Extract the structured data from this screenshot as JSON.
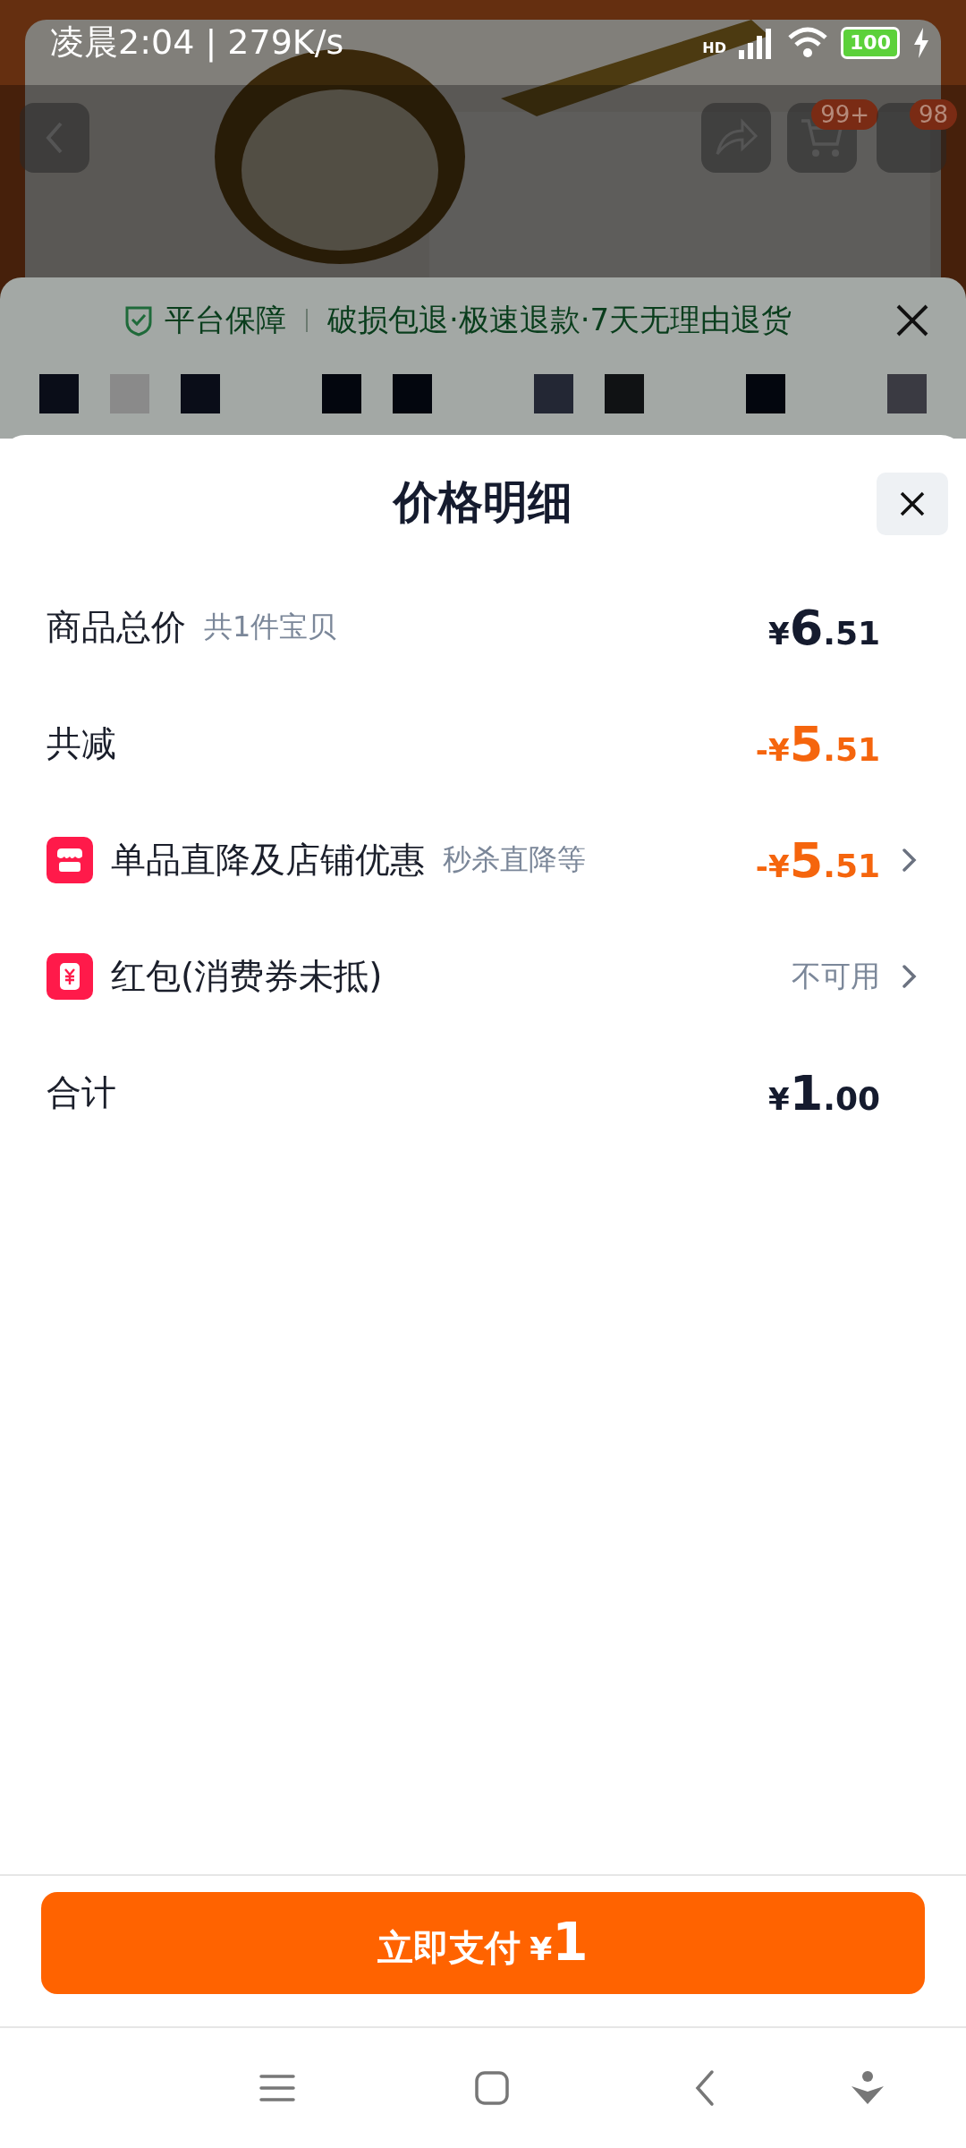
{
  "status_bar": {
    "time": "凌晨2:04 | 279K/s",
    "network": "HD",
    "battery": "100"
  },
  "product_header": {
    "cart_badge": "99+",
    "message_badge": "98"
  },
  "guarantee_bar": {
    "title": "平台保障",
    "text": "破损包退·极速退款·7天无理由退货"
  },
  "sheet": {
    "title": "价格明细",
    "rows": [
      {
        "kind": "plain",
        "label": "商品总价",
        "note": "共1件宝贝",
        "currency": "¥",
        "integer": "6",
        "decimal": ".51",
        "highlight": false,
        "expandable": false
      },
      {
        "kind": "plain",
        "label": "共减",
        "currency": "-¥",
        "integer": "5",
        "decimal": ".51",
        "highlight": true,
        "expandable": false
      },
      {
        "kind": "shop",
        "label": "单品直降及店铺优惠",
        "note": "秒杀直降等",
        "currency": "-¥",
        "integer": "5",
        "decimal": ".51",
        "highlight": true,
        "expandable": true
      },
      {
        "kind": "coupon",
        "label": "红包(消费券未抵)",
        "status": "不可用",
        "expandable": true
      },
      {
        "kind": "plain",
        "label": "合计",
        "currency": "¥",
        "integer": "1",
        "decimal": ".00",
        "highlight": false,
        "expandable": false
      }
    ]
  },
  "pay_button": {
    "label": "立即支付",
    "currency": "¥",
    "amount": "1"
  }
}
